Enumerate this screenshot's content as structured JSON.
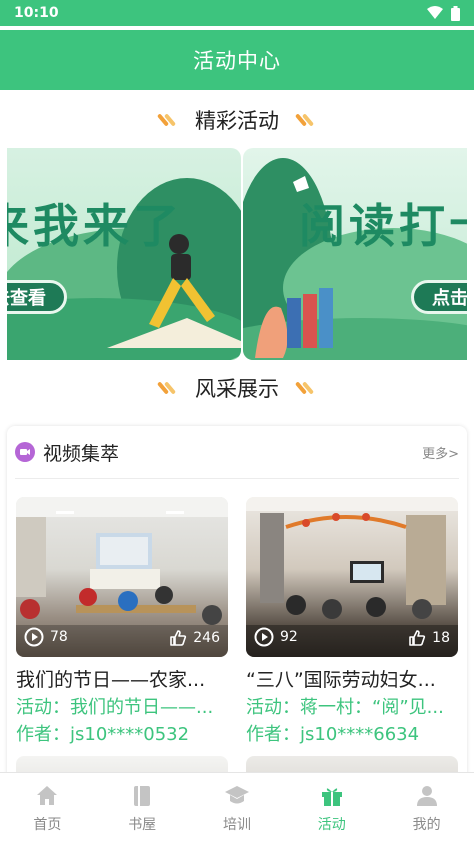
{
  "status_bar": {
    "time": "10:10"
  },
  "header": {
    "title": "活动中心"
  },
  "sections": {
    "featured_title": "精彩活动",
    "showcase_title": "风采展示"
  },
  "banners": [
    {
      "headline": "来我来了",
      "button": "去查看"
    },
    {
      "headline": "阅读打卡",
      "button": "点击"
    }
  ],
  "video_section": {
    "title": "视频集萃",
    "more": "更多>",
    "items": [
      {
        "plays": "78",
        "likes": "246",
        "title": "我们的节日——农家...",
        "activity": "活动：我们的节日——...",
        "author": "作者：js10****0532"
      },
      {
        "plays": "92",
        "likes": "18",
        "title": "“三八”国际劳动妇女...",
        "activity": "活动：蒋一村：“阅”见...",
        "author": "作者：js10****6634"
      }
    ]
  },
  "tabbar": {
    "items": [
      {
        "label": "首页",
        "icon": "home-icon"
      },
      {
        "label": "书屋",
        "icon": "book-icon"
      },
      {
        "label": "培训",
        "icon": "graduation-cap-icon"
      },
      {
        "label": "活动",
        "icon": "gift-icon"
      },
      {
        "label": "我的",
        "icon": "user-icon"
      }
    ],
    "active_index": 3
  },
  "colors": {
    "primary": "#3dc47e",
    "accent_orange": "#f2a13a",
    "inactive": "#8a8a8a"
  }
}
